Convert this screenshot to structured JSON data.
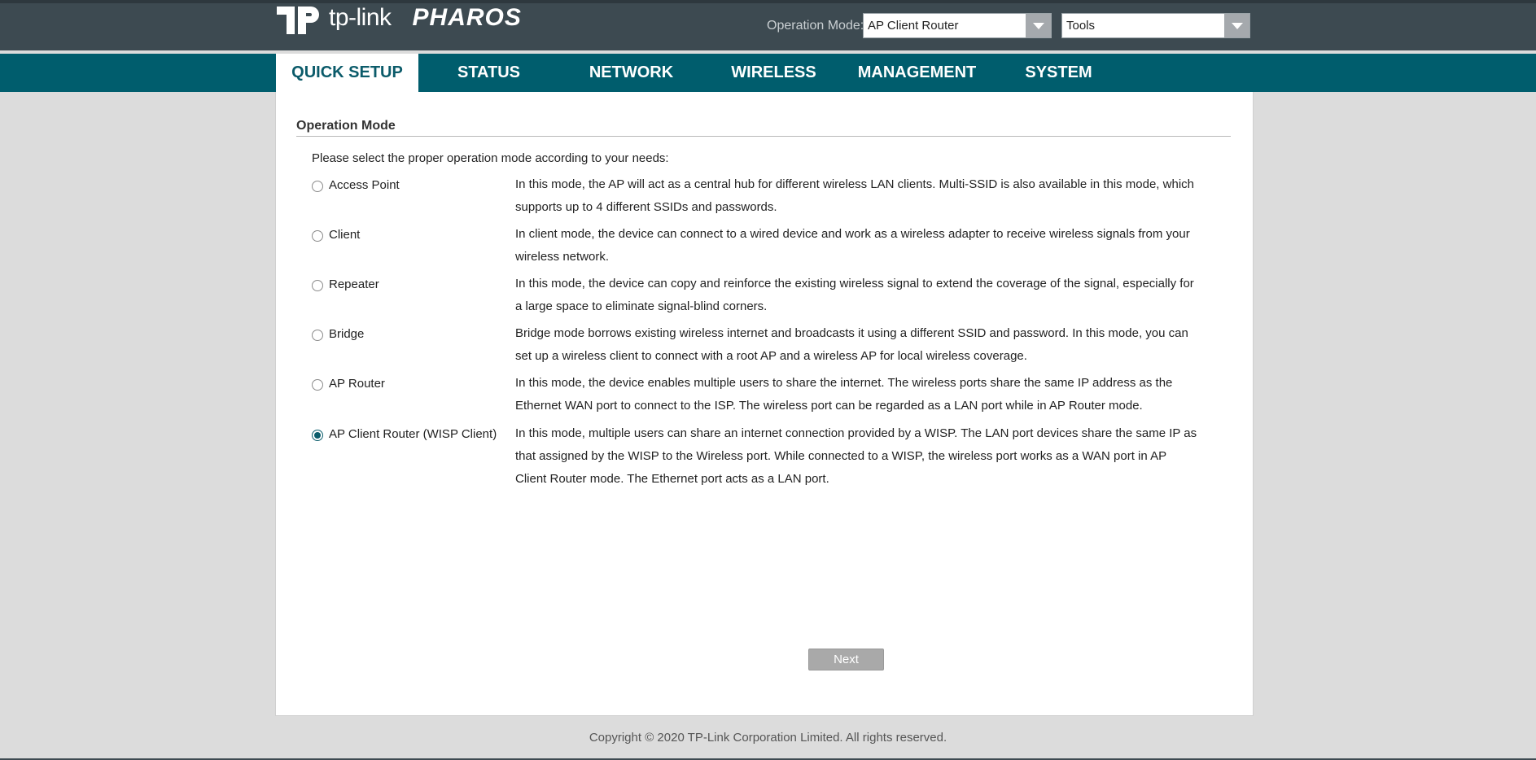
{
  "header": {
    "brand_name": "tp-link",
    "product_name": "PHAROS",
    "operation_mode_label": "Operation Mode:",
    "operation_mode_value": "AP Client Router",
    "tools_value": "Tools"
  },
  "nav": {
    "items": [
      {
        "label": "QUICK SETUP",
        "active": true
      },
      {
        "label": "STATUS"
      },
      {
        "label": "NETWORK"
      },
      {
        "label": "WIRELESS"
      },
      {
        "label": "MANAGEMENT"
      },
      {
        "label": "SYSTEM"
      }
    ]
  },
  "main": {
    "section_title": "Operation Mode",
    "intro": "Please select the proper operation mode according to your needs:",
    "modes": [
      {
        "label": "Access Point",
        "checked": false,
        "description": "In this mode, the AP will act as a central hub for different wireless LAN clients. Multi-SSID is also available in this mode, which supports up to 4 different SSIDs and passwords."
      },
      {
        "label": "Client",
        "checked": false,
        "description": "In client mode, the device can connect to a wired device and work as a wireless adapter to receive wireless signals from your wireless network."
      },
      {
        "label": "Repeater",
        "checked": false,
        "description": "In this mode, the device can copy and reinforce the existing wireless signal to extend the coverage of the signal, especially for a large space to eliminate signal-blind corners."
      },
      {
        "label": "Bridge",
        "checked": false,
        "description": "Bridge mode borrows existing wireless internet and broadcasts it using a different SSID and password. In this mode, you can set up a wireless client to connect with a root AP and a wireless AP for local wireless coverage."
      },
      {
        "label": "AP Router",
        "checked": false,
        "description": "In this mode, the device enables multiple users to share the internet. The wireless ports share the same IP address as the Ethernet WAN port to connect to the ISP. The wireless port can be regarded as a LAN port while in AP Router mode."
      },
      {
        "label": "AP Client Router (WISP Client)",
        "checked": true,
        "description": "In this mode, multiple users can share an internet connection provided by a WISP. The LAN port devices share the same IP as that assigned by the WISP to the Wireless port. While connected to a WISP, the wireless port works as a WAN port in AP Client Router mode. The Ethernet port acts as a LAN port."
      }
    ],
    "next_label": "Next"
  },
  "footer": {
    "copyright": "Copyright © 2020 TP-Link Corporation Limited. All rights reserved."
  },
  "colors": {
    "header_bg": "#3d4a51",
    "nav_bg": "#005d6d",
    "accent": "#0a5c6b",
    "button_bg": "#a9a9a9"
  }
}
